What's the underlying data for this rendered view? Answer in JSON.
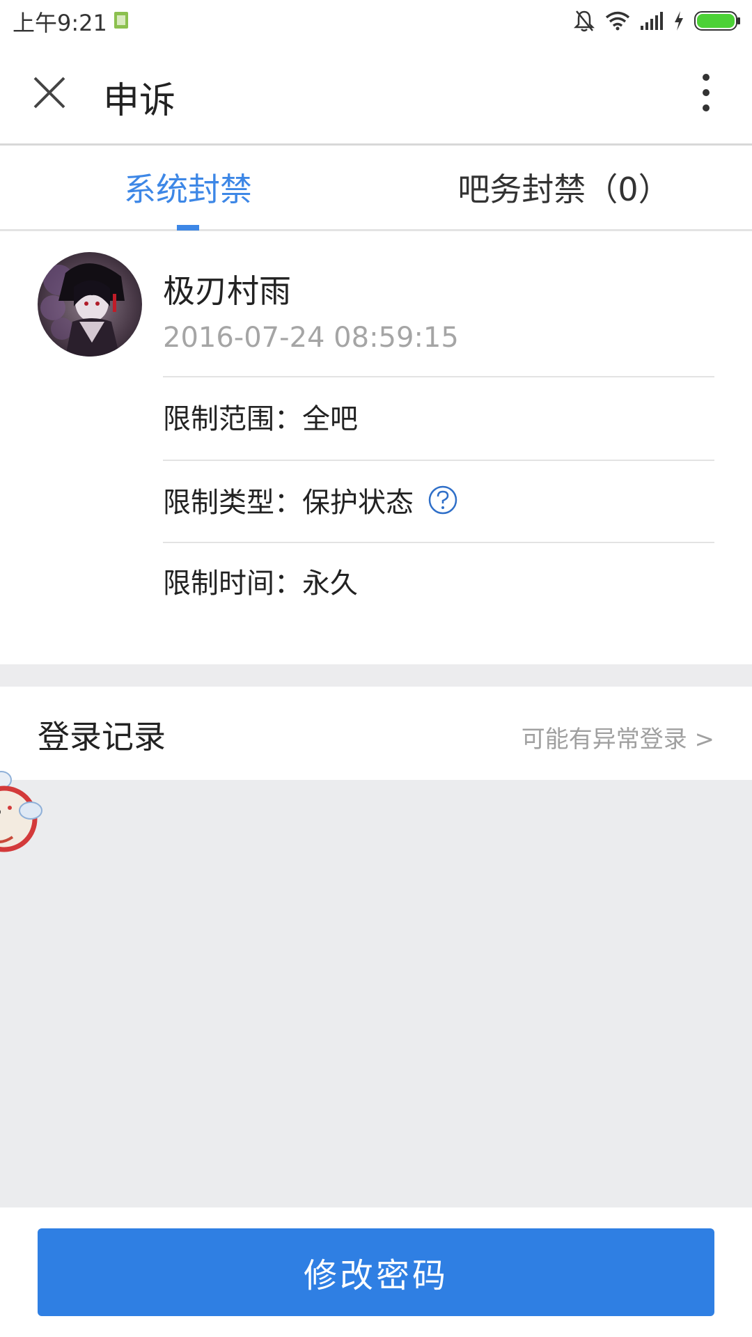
{
  "status_bar": {
    "time": "上午9:21",
    "battery_color": "#4cd136"
  },
  "header": {
    "title": "申诉",
    "close_icon": "close-icon",
    "more_icon": "more-vertical-icon"
  },
  "tabs": [
    {
      "label": "系统封禁",
      "active": true
    },
    {
      "label": "吧务封禁（0）",
      "active": false
    }
  ],
  "ban": {
    "username": "极刃村雨",
    "timestamp": "2016-07-24 08:59:15",
    "scope": "限制范围：全吧",
    "type": "限制类型：保护状态",
    "duration": "限制时间：永久"
  },
  "login_records": {
    "title": "登录记录",
    "abnormal_link": "可能有异常登录 >"
  },
  "actions": {
    "change_password": "修改密码"
  },
  "colors": {
    "accent": "#3d87e6",
    "button": "#2f7fe3",
    "muted_text": "#a5a5a5",
    "section_bg": "#ebecee"
  }
}
